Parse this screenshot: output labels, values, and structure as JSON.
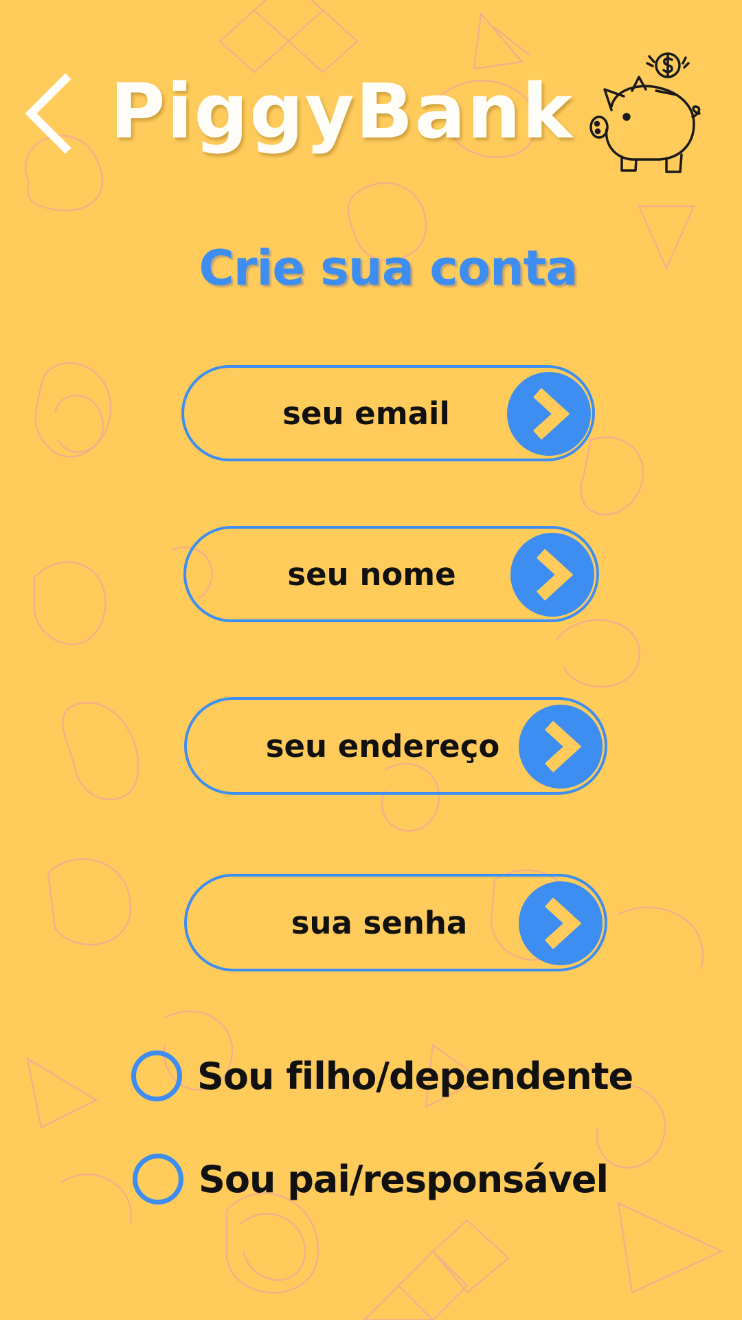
{
  "app": {
    "title": "PiggyBank"
  },
  "header": {
    "back_icon": "chevron-left-icon",
    "logo_icon": "piggy-bank-coin-icon"
  },
  "page": {
    "title": "Crie sua conta"
  },
  "form": {
    "fields": [
      {
        "label": "seu email",
        "button_icon": "chevron-right-icon"
      },
      {
        "label": "seu nome",
        "button_icon": "chevron-right-icon"
      },
      {
        "label": "seu endereço",
        "button_icon": "chevron-right-icon"
      },
      {
        "label": "sua senha",
        "button_icon": "chevron-right-icon"
      }
    ],
    "account_type": {
      "options": [
        {
          "label": "Sou filho/dependente",
          "selected": false
        },
        {
          "label": "Sou pai/responsável",
          "selected": false
        }
      ]
    }
  },
  "colors": {
    "background": "#ffcc5c",
    "accent": "#3d8ef0",
    "title_text": "#fffdf8",
    "body_text": "#111111",
    "doodles": "#f0a0a0"
  }
}
